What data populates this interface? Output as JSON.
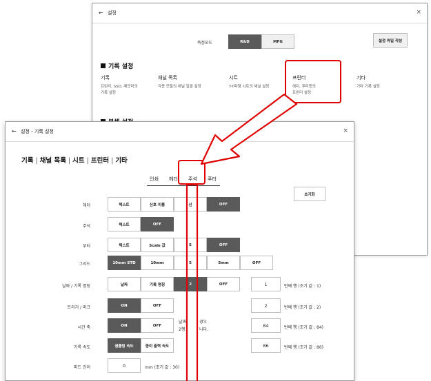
{
  "bg_window": {
    "back_icon": "←",
    "title": "설정",
    "close_icon": "×",
    "mode_label": "측정모드",
    "mode_options": [
      "R&D",
      "MFG"
    ],
    "create_file_button": "설정 파일 작성",
    "section_title": "기록 설정",
    "categories": [
      {
        "title": "기록",
        "desc1": "프린터, SSD, 메모리의",
        "desc2": "기록 설정"
      },
      {
        "title": "채널 목록",
        "desc1": "각종 모듈의 채널 일괄 설정",
        "desc2": ""
      },
      {
        "title": "시트",
        "desc1": "Y-T파형 시트의 채널 설정",
        "desc2": ""
      },
      {
        "title": "프린터",
        "desc1": "헤더, 푸터등의",
        "desc2": "프린터 설정"
      },
      {
        "title": "기타",
        "desc1": "기타 기록 설정",
        "desc2": ""
      }
    ],
    "section2_partial": "본체 설정"
  },
  "fg_window": {
    "back_icon": "←",
    "title": "설정 - 기록 설정",
    "close_icon": "×",
    "nav": [
      "기록",
      "채널 목록",
      "시트",
      "프린터",
      "기타"
    ],
    "tabs": [
      "인쇄",
      "헤더",
      "주석",
      "푸터"
    ],
    "reset_button": "초기화",
    "rows": {
      "header": {
        "label": "헤더",
        "buttons": [
          "텍스트",
          "신호 이름",
          "신",
          "OFF"
        ]
      },
      "annotation": {
        "label": "주석",
        "buttons": [
          "텍스트",
          "OFF"
        ]
      },
      "footer": {
        "label": "푸터",
        "buttons": [
          "텍스트",
          "Scale 값",
          "S",
          "OFF"
        ]
      },
      "grid": {
        "label": "그리드",
        "buttons": [
          "10mm STD",
          "10mm",
          "5",
          "5mm",
          "OFF"
        ]
      },
      "date": {
        "label": "날짜 / 기록 명칭",
        "buttons": [
          "날짜",
          "기록 명칭",
          "2",
          "OFF"
        ],
        "value": "1",
        "note": "번째 행 (조기 값 : 1)"
      },
      "trigger": {
        "label": "트리거 / 마크",
        "buttons": [
          "ON",
          "OFF"
        ],
        "value": "2",
        "note": "번째 행 (조기 값 : 2)"
      },
      "timeaxis": {
        "label": "시간 축",
        "buttons": [
          "ON",
          "OFF"
        ],
        "desc1": "날짜",
        "desc1b": "경우",
        "desc2": "2행",
        "desc2b": "니다.",
        "value": "84",
        "note": "번째 행 (조기 값 : 84)"
      },
      "speed": {
        "label": "기록 속도",
        "buttons": [
          "샘플링 속도",
          "종이 출력 속도"
        ],
        "value": "86",
        "note": "번째 행 (조기 값 : 86)"
      },
      "feed": {
        "label": "피드 간이",
        "value": "0",
        "note": "mm (초기 값 : 30)"
      }
    }
  },
  "colors": {
    "annotation_red": "#e00000",
    "selected_dark": "#5a5a5a"
  }
}
